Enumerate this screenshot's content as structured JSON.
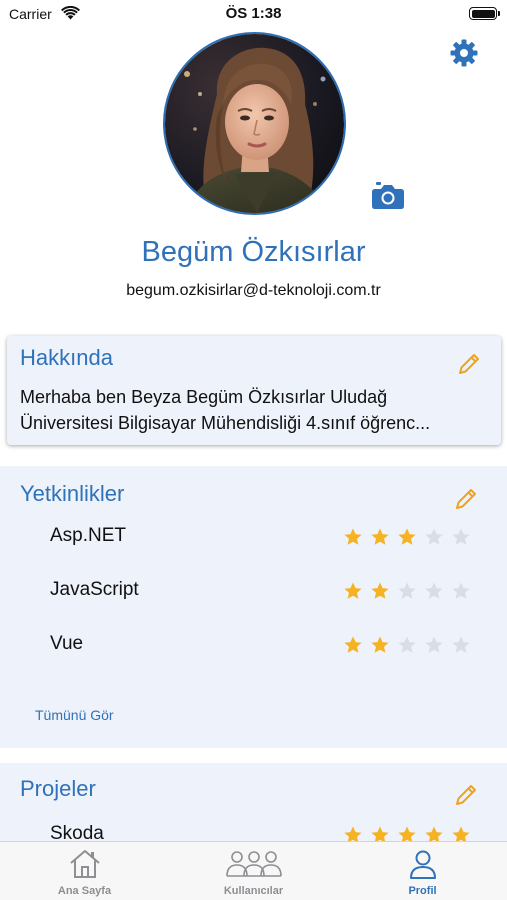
{
  "status_bar": {
    "carrier": "Carrier",
    "time": "ÖS 1:38",
    "battery_level_fraction": 1.0
  },
  "profile": {
    "name": "Begüm Özkısırlar",
    "email": "begum.ozkisirlar@d-teknoloji.com.tr",
    "avatar_icon": "avatar-photo",
    "settings_icon": "gear-icon",
    "camera_icon": "camera-icon"
  },
  "about": {
    "title": "Hakkında",
    "line1": "Merhaba ben Beyza Begüm Özkısırlar Uludağ",
    "line2": "Üniversitesi Bilgisayar Mühendisliği 4.sınıf öğrenc..."
  },
  "skills": {
    "title": "Yetkinlikler",
    "items": [
      {
        "name": "Asp.NET",
        "rating": 3,
        "max": 5
      },
      {
        "name": "JavaScript",
        "rating": 2,
        "max": 5
      },
      {
        "name": "Vue",
        "rating": 2,
        "max": 5
      }
    ],
    "see_all_label": "Tümünü Gör"
  },
  "projects": {
    "title": "Projeler",
    "items": [
      {
        "name": "Skoda",
        "rating": 5,
        "max": 5
      }
    ]
  },
  "tabs": [
    {
      "label": "Ana Sayfa",
      "icon": "home-icon",
      "active": false
    },
    {
      "label": "Kullanıcılar",
      "icon": "users-icon",
      "active": false
    },
    {
      "label": "Profil",
      "icon": "person-icon",
      "active": true
    }
  ],
  "colors": {
    "accent": "#2f72b9",
    "star_filled": "#f5b324",
    "star_empty": "#d9dde4",
    "card_background": "#eef2fb",
    "edit_pencil": "#f0a31c"
  }
}
